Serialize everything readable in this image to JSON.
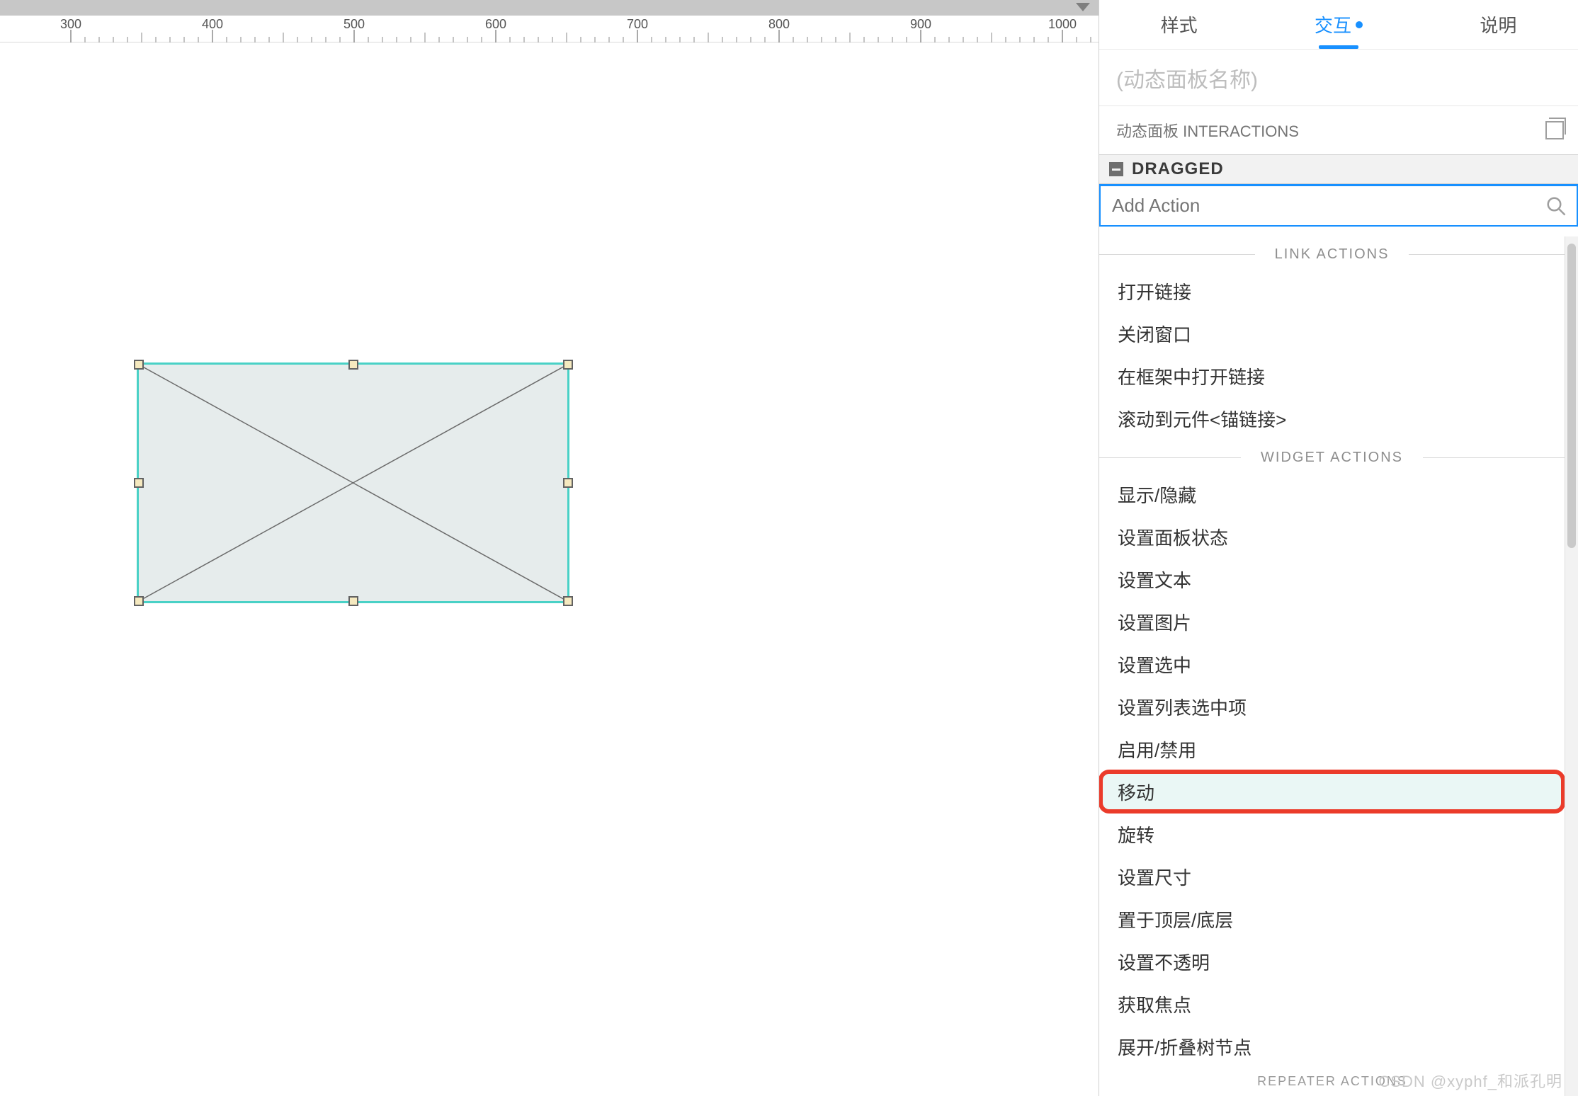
{
  "ruler": {
    "marks": [
      300,
      400,
      500,
      600,
      700,
      800,
      900,
      1000
    ]
  },
  "panel": {
    "tabs": {
      "style": "样式",
      "interactions": "交互",
      "notes": "说明"
    },
    "name_placeholder": "(动态面板名称)",
    "section_label": "动态面板 INTERACTIONS",
    "event": "DRAGGED",
    "search_placeholder": "Add Action",
    "groups": {
      "link": {
        "title": "LINK ACTIONS",
        "items": [
          "打开链接",
          "关闭窗口",
          "在框架中打开链接",
          "滚动到元件<锚链接>"
        ]
      },
      "widget": {
        "title": "WIDGET ACTIONS",
        "items": [
          "显示/隐藏",
          "设置面板状态",
          "设置文本",
          "设置图片",
          "设置选中",
          "设置列表选中项",
          "启用/禁用",
          "移动",
          "旋转",
          "设置尺寸",
          "置于顶层/底层",
          "设置不透明",
          "获取焦点",
          "展开/折叠树节点"
        ]
      },
      "next_title": "REPEATER ACTIONS"
    },
    "highlight": "移动"
  },
  "watermark": "CSDN @xyphf_和派孔明"
}
